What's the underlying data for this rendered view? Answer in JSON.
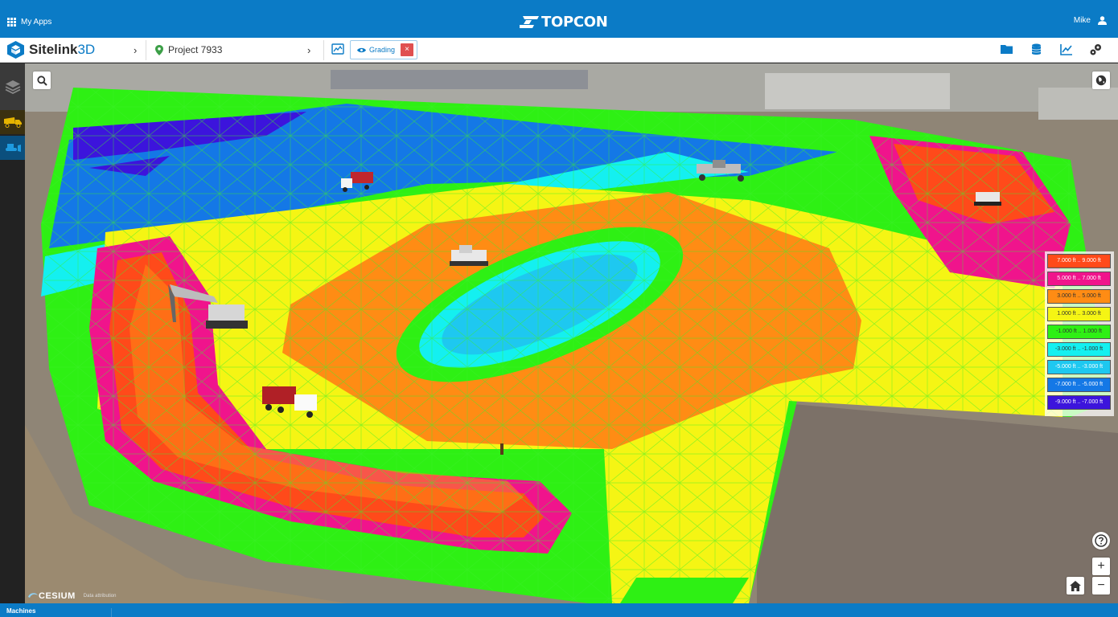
{
  "topbar": {
    "apps_label": "My Apps",
    "brand": "TOPCON",
    "user_name": "Mike"
  },
  "navbar": {
    "product_name": "Sitelink",
    "product_suffix": "3D",
    "project_name": "Project 7933",
    "active_tab_label": "Grading",
    "close_label": "×",
    "icons": [
      "folder-icon",
      "database-icon",
      "chart-icon",
      "settings-network-icon"
    ]
  },
  "sidebar": {
    "items": [
      "layers-icon",
      "dump-truck-icon",
      "dozer-icon"
    ]
  },
  "map": {
    "zoom_in": "+",
    "zoom_out": "−",
    "help_icon": "help-icon",
    "home_icon": "home-icon",
    "globe_icon": "globe-icon",
    "search_icon": "search-icon",
    "attribution_logo": "CESIUM",
    "attribution_text": "Data attribution",
    "legend": [
      {
        "label": "7.000 ft .. 9.000 ft",
        "color": "#ff4a1a"
      },
      {
        "label": "5.000 ft .. 7.000 ft",
        "color": "#f0148c"
      },
      {
        "label": "3.000 ft .. 5.000 ft",
        "color": "#ff8c14"
      },
      {
        "label": "1.000 ft .. 3.000 ft",
        "color": "#f5f514"
      },
      {
        "label": "-1.000 ft .. 1.000 ft",
        "color": "#2ef014"
      },
      {
        "label": "-3.000 ft .. -1.000 ft",
        "color": "#14f0f0"
      },
      {
        "label": "-5.000 ft .. -3.000 ft",
        "color": "#1ec8f0"
      },
      {
        "label": "-7.000 ft .. -5.000 ft",
        "color": "#1478e6"
      },
      {
        "label": "-9.000 ft .. -7.000 ft",
        "color": "#3c14dc"
      }
    ]
  },
  "bottombar": {
    "tab_label": "Machines"
  }
}
